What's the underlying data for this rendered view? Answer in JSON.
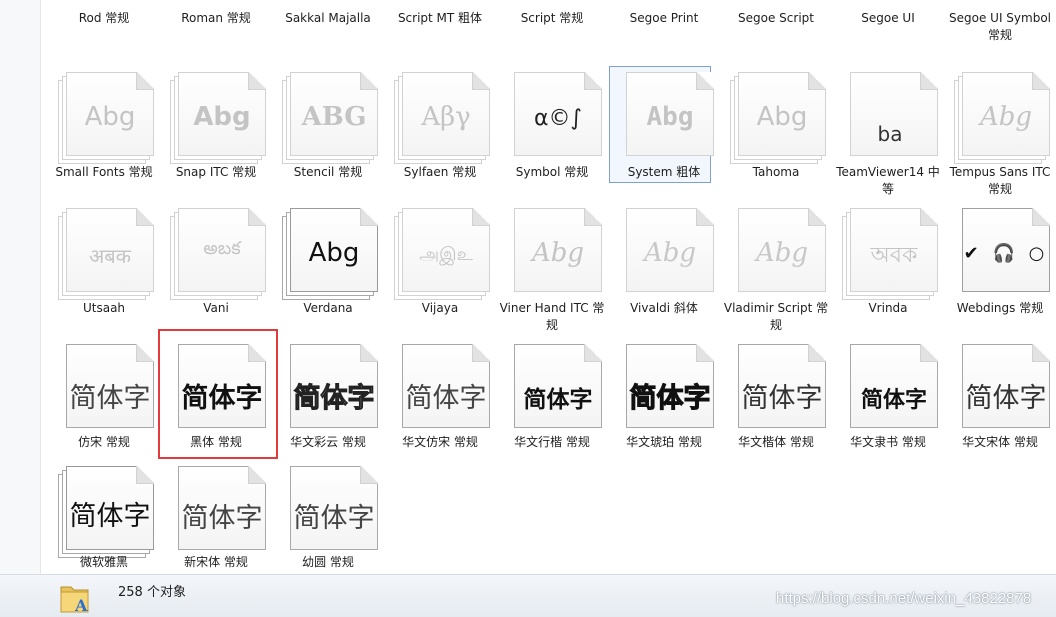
{
  "fonts_row0": [
    {
      "label": "Rod 常规"
    },
    {
      "label": "Roman 常规"
    },
    {
      "label": "Sakkal Majalla"
    },
    {
      "label": "Script MT 粗体"
    },
    {
      "label": "Script 常规"
    },
    {
      "label": "Segoe Print"
    },
    {
      "label": "Segoe Script"
    },
    {
      "label": "Segoe UI"
    },
    {
      "label": "Segoe UI Symbol 常规"
    }
  ],
  "fonts_row1": [
    {
      "label": "Small Fonts 常规",
      "sample": "Abg",
      "icon": "font-file-icon"
    },
    {
      "label": "Snap ITC 常规",
      "sample": "Abg",
      "icon": "font-file-icon"
    },
    {
      "label": "Stencil 常规",
      "sample": "ABG",
      "icon": "font-file-icon"
    },
    {
      "label": "Sylfaen 常规",
      "sample": "Aβγ",
      "icon": "font-file-icon"
    },
    {
      "label": "Symbol 常规",
      "sample": "α©∫",
      "icon": "font-file-icon"
    },
    {
      "label": "System 粗体",
      "sample": "Abg",
      "icon": "font-file-icon"
    },
    {
      "label": "Tahoma",
      "sample": "Abg",
      "icon": "font-file-icon"
    },
    {
      "label": "TeamViewer14 中等",
      "sample": "ba",
      "icon": "font-file-icon"
    },
    {
      "label": "Tempus Sans ITC 常规",
      "sample": "Abg",
      "icon": "font-file-icon"
    }
  ],
  "fonts_row2": [
    {
      "label": "Utsaah",
      "sample": "अबक",
      "icon": "font-file-icon"
    },
    {
      "label": "Vani",
      "sample": "అబక",
      "icon": "font-file-icon"
    },
    {
      "label": "Verdana",
      "sample": "Abg",
      "icon": "font-file-icon"
    },
    {
      "label": "Vijaya",
      "sample": "அஇஉ",
      "icon": "font-file-icon"
    },
    {
      "label": "Viner Hand ITC 常规",
      "sample": "Abg",
      "icon": "font-file-icon"
    },
    {
      "label": "Vivaldi 斜体",
      "sample": "Abg",
      "icon": "font-file-icon"
    },
    {
      "label": "Vladimir Script 常规",
      "sample": "Abg",
      "icon": "font-file-icon"
    },
    {
      "label": "Vrinda",
      "sample": "অবক",
      "icon": "font-file-icon"
    },
    {
      "label": "Webdings 常规",
      "sample": "✔ 🎧 ○",
      "icon": "font-file-icon"
    }
  ],
  "fonts_row3": [
    {
      "label": "仿宋 常规",
      "sample": "简体字"
    },
    {
      "label": "黑体 常规",
      "sample": "简体字"
    },
    {
      "label": "华文彩云 常规",
      "sample": "简体字"
    },
    {
      "label": "华文仿宋 常规",
      "sample": "简体字"
    },
    {
      "label": "华文行楷 常规",
      "sample": "简体字"
    },
    {
      "label": "华文琥珀 常规",
      "sample": "简体字"
    },
    {
      "label": "华文楷体 常规",
      "sample": "简体字"
    },
    {
      "label": "华文隶书 常规",
      "sample": "简体字"
    },
    {
      "label": "华文宋体 常规",
      "sample": "简体字"
    }
  ],
  "fonts_row4": [
    {
      "label": "微软雅黑",
      "sample": "简体字"
    },
    {
      "label": "新宋体 常规",
      "sample": "简体字"
    },
    {
      "label": "幼圆 常规",
      "sample": "简体字"
    }
  ],
  "selection": {
    "highlighted": "System 粗体",
    "annotated": "黑体 常规",
    "annotation_color": "#e23b3b"
  },
  "status": {
    "count_text": "258 个对象",
    "icon": "folder-fonts-icon"
  },
  "watermark": "https://blog.csdn.net/weixin_43822878"
}
